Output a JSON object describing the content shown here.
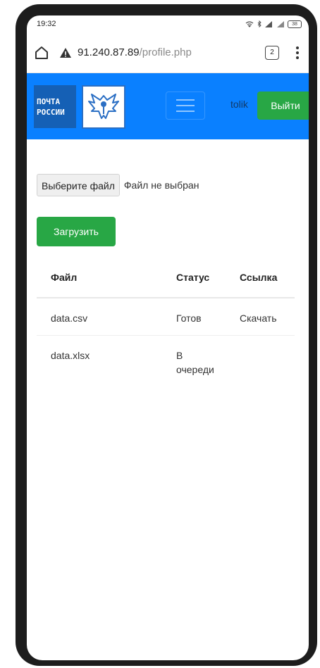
{
  "status_bar": {
    "time": "19:32",
    "battery": "38"
  },
  "browser": {
    "url_host": "91.240.87.89",
    "url_path": "/profile.php",
    "tab_count": "2"
  },
  "navbar": {
    "logo_line1": "ПОЧТА",
    "logo_line2": "РОССИИ",
    "username": "tolik",
    "logout_label": "Выйти",
    "brand_color": "#0a80ff",
    "button_color": "#28a745"
  },
  "upload": {
    "choose_file_label": "Выберите файл",
    "no_file_text": "Файл не выбран",
    "upload_label": "Загрузить"
  },
  "table": {
    "columns": [
      "Файл",
      "Статус",
      "Ссылка"
    ],
    "rows": [
      {
        "file": "data.csv",
        "status": "Готов",
        "link": "Скачать"
      },
      {
        "file": "data.xlsx",
        "status": "В очереди",
        "link": ""
      }
    ]
  }
}
